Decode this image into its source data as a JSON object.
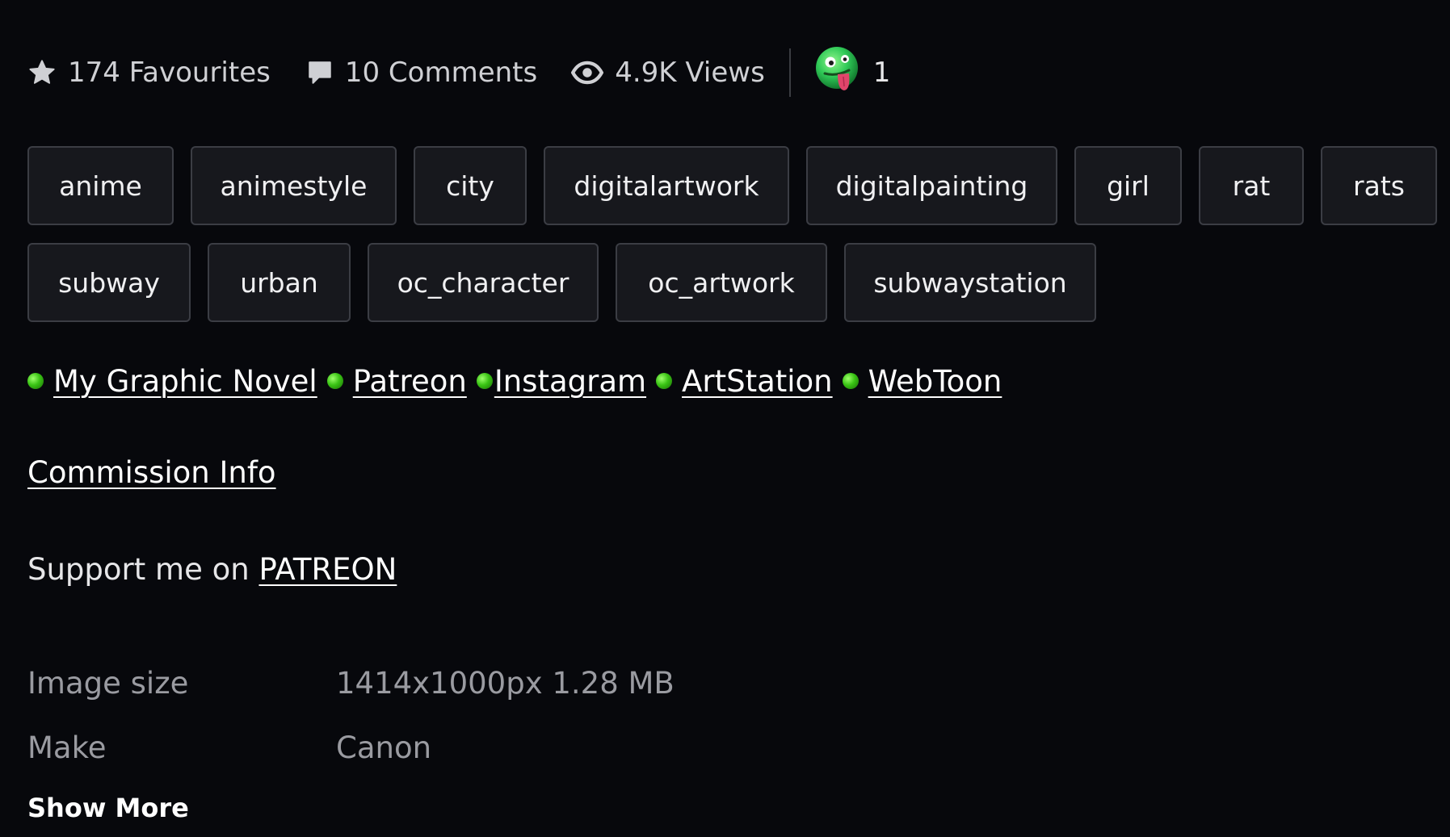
{
  "stats": {
    "favourites": "174 Favourites",
    "comments": "10 Comments",
    "views": "4.9K Views",
    "reaction_count": "1"
  },
  "tags": {
    "row1": [
      "anime",
      "animestyle",
      "city",
      "digitalartwork",
      "digitalpainting",
      "girl",
      "rat",
      "rats"
    ],
    "row2": [
      "subway",
      "urban",
      "oc_character",
      "oc_artwork",
      "subwaystation"
    ]
  },
  "links": {
    "graphic_novel": "My Graphic Novel",
    "patreon": "Patreon",
    "instagram": "Instagram",
    "artstation": "ArtStation",
    "webtoon": "WebToon"
  },
  "commission": "Commission Info",
  "support": {
    "prefix": "Support me on ",
    "link": "PATREON"
  },
  "details": {
    "image_size_label": "Image size",
    "image_size_value": "1414x1000px 1.28 MB",
    "make_label": "Make",
    "make_value": "Canon"
  },
  "show_more": "Show More",
  "colors": {
    "background": "#07080c",
    "tag_bg": "#17181d",
    "tag_border": "#3b3d44",
    "bullet_green": "#39c314"
  },
  "icons": {
    "favourites": "star-icon",
    "comments": "speech-bubble-icon",
    "views": "eye-icon",
    "reaction": "zany-face-emoji-icon",
    "bullet": "green-dot-icon"
  }
}
